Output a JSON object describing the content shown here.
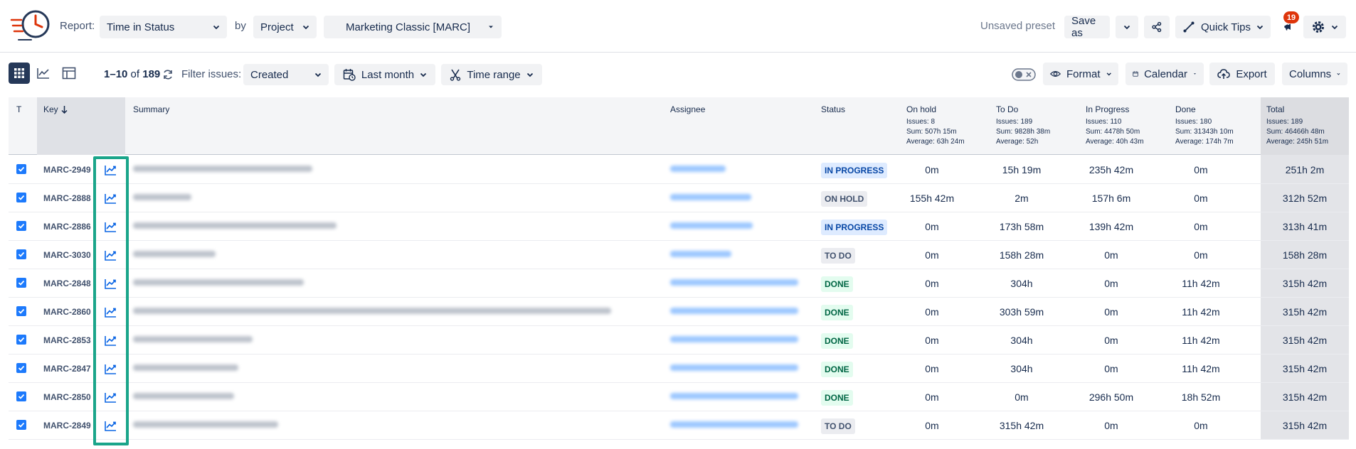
{
  "header": {
    "report_label": "Report:",
    "report_value": "Time in Status",
    "by_label": "by",
    "by_value": "Project",
    "project_value": "Marketing Classic [MARC]",
    "unsaved_preset": "Unsaved preset",
    "save_as": "Save as",
    "quick_tips": "Quick Tips",
    "notifications_count": "19"
  },
  "toolbar": {
    "range_start": "1",
    "range_end": "10",
    "range_of": "of",
    "total": "189",
    "filter_label": "Filter issues:",
    "filter_value": "Created",
    "date_value": "Last month",
    "time_range": "Time range",
    "format": "Format",
    "calendar": "Calendar",
    "export": "Export",
    "columns": "Columns"
  },
  "columns": {
    "t": "T",
    "key": "Key",
    "summary": "Summary",
    "assignee": "Assignee",
    "status": "Status",
    "on_hold": {
      "title": "On hold",
      "issues": "Issues: 8",
      "sum": "Sum: 507h 15m",
      "avg": "Average: 63h 24m"
    },
    "to_do": {
      "title": "To Do",
      "issues": "Issues: 189",
      "sum": "Sum: 9828h 38m",
      "avg": "Average: 52h"
    },
    "in_progress": {
      "title": "In Progress",
      "issues": "Issues: 110",
      "sum": "Sum: 4478h 50m",
      "avg": "Average: 40h 43m"
    },
    "done": {
      "title": "Done",
      "issues": "Issues: 180",
      "sum": "Sum: 31343h 10m",
      "avg": "Average: 174h 7m"
    },
    "total": {
      "title": "Total",
      "issues": "Issues: 189",
      "sum": "Sum: 46466h 48m",
      "avg": "Average: 245h 51m"
    }
  },
  "rows": [
    {
      "key": "MARC-2949",
      "status": "IN PROGRESS",
      "on_hold": "0m",
      "to_do": "15h 19m",
      "in_progress": "235h 42m",
      "done": "0m",
      "total": "251h 2m"
    },
    {
      "key": "MARC-2888",
      "status": "ON HOLD",
      "on_hold": "155h 42m",
      "to_do": "2m",
      "in_progress": "157h 6m",
      "done": "0m",
      "total": "312h 52m"
    },
    {
      "key": "MARC-2886",
      "status": "IN PROGRESS",
      "on_hold": "0m",
      "to_do": "173h 58m",
      "in_progress": "139h 42m",
      "done": "0m",
      "total": "313h 41m"
    },
    {
      "key": "MARC-3030",
      "status": "TO DO",
      "on_hold": "0m",
      "to_do": "158h 28m",
      "in_progress": "0m",
      "done": "0m",
      "total": "158h 28m"
    },
    {
      "key": "MARC-2848",
      "status": "DONE",
      "on_hold": "0m",
      "to_do": "304h",
      "in_progress": "0m",
      "done": "11h 42m",
      "total": "315h 42m"
    },
    {
      "key": "MARC-2860",
      "status": "DONE",
      "on_hold": "0m",
      "to_do": "303h 59m",
      "in_progress": "0m",
      "done": "11h 42m",
      "total": "315h 42m"
    },
    {
      "key": "MARC-2853",
      "status": "DONE",
      "on_hold": "0m",
      "to_do": "304h",
      "in_progress": "0m",
      "done": "11h 42m",
      "total": "315h 42m"
    },
    {
      "key": "MARC-2847",
      "status": "DONE",
      "on_hold": "0m",
      "to_do": "304h",
      "in_progress": "0m",
      "done": "11h 42m",
      "total": "315h 42m"
    },
    {
      "key": "MARC-2850",
      "status": "DONE",
      "on_hold": "0m",
      "to_do": "0m",
      "in_progress": "296h 50m",
      "done": "18h 52m",
      "total": "315h 42m"
    },
    {
      "key": "MARC-2849",
      "status": "TO DO",
      "on_hold": "0m",
      "to_do": "315h 42m",
      "in_progress": "0m",
      "done": "0m",
      "total": "315h 42m"
    }
  ],
  "colors": {
    "accent": "#1d7afc",
    "highlight": "#1aa58a",
    "active_view": "#253858"
  }
}
